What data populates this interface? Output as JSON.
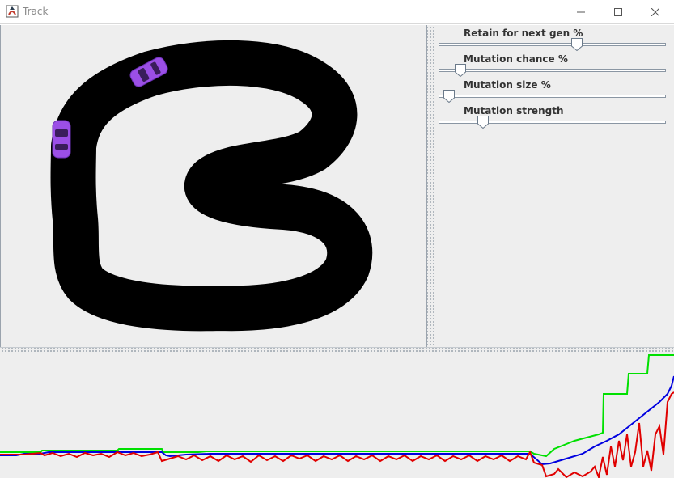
{
  "window": {
    "title": "Track",
    "icon": "java-app-icon",
    "controls": [
      "minimize-icon",
      "maximize-icon",
      "close-icon"
    ]
  },
  "track": {
    "road_color": "#000000",
    "car_color": "#9b4fe6",
    "cars": 2
  },
  "settings": {
    "sliders": [
      {
        "label": "Retain for next gen %",
        "value": 0.61
      },
      {
        "label": "Mutation chance %",
        "value": 0.09
      },
      {
        "label": "Mutation size %",
        "value": 0.04
      },
      {
        "label": "Mutation strength",
        "value": 0.19
      }
    ]
  },
  "graph": {
    "series_colors": {
      "green": "#00e000",
      "blue": "#0000e0",
      "red": "#e00000"
    }
  }
}
